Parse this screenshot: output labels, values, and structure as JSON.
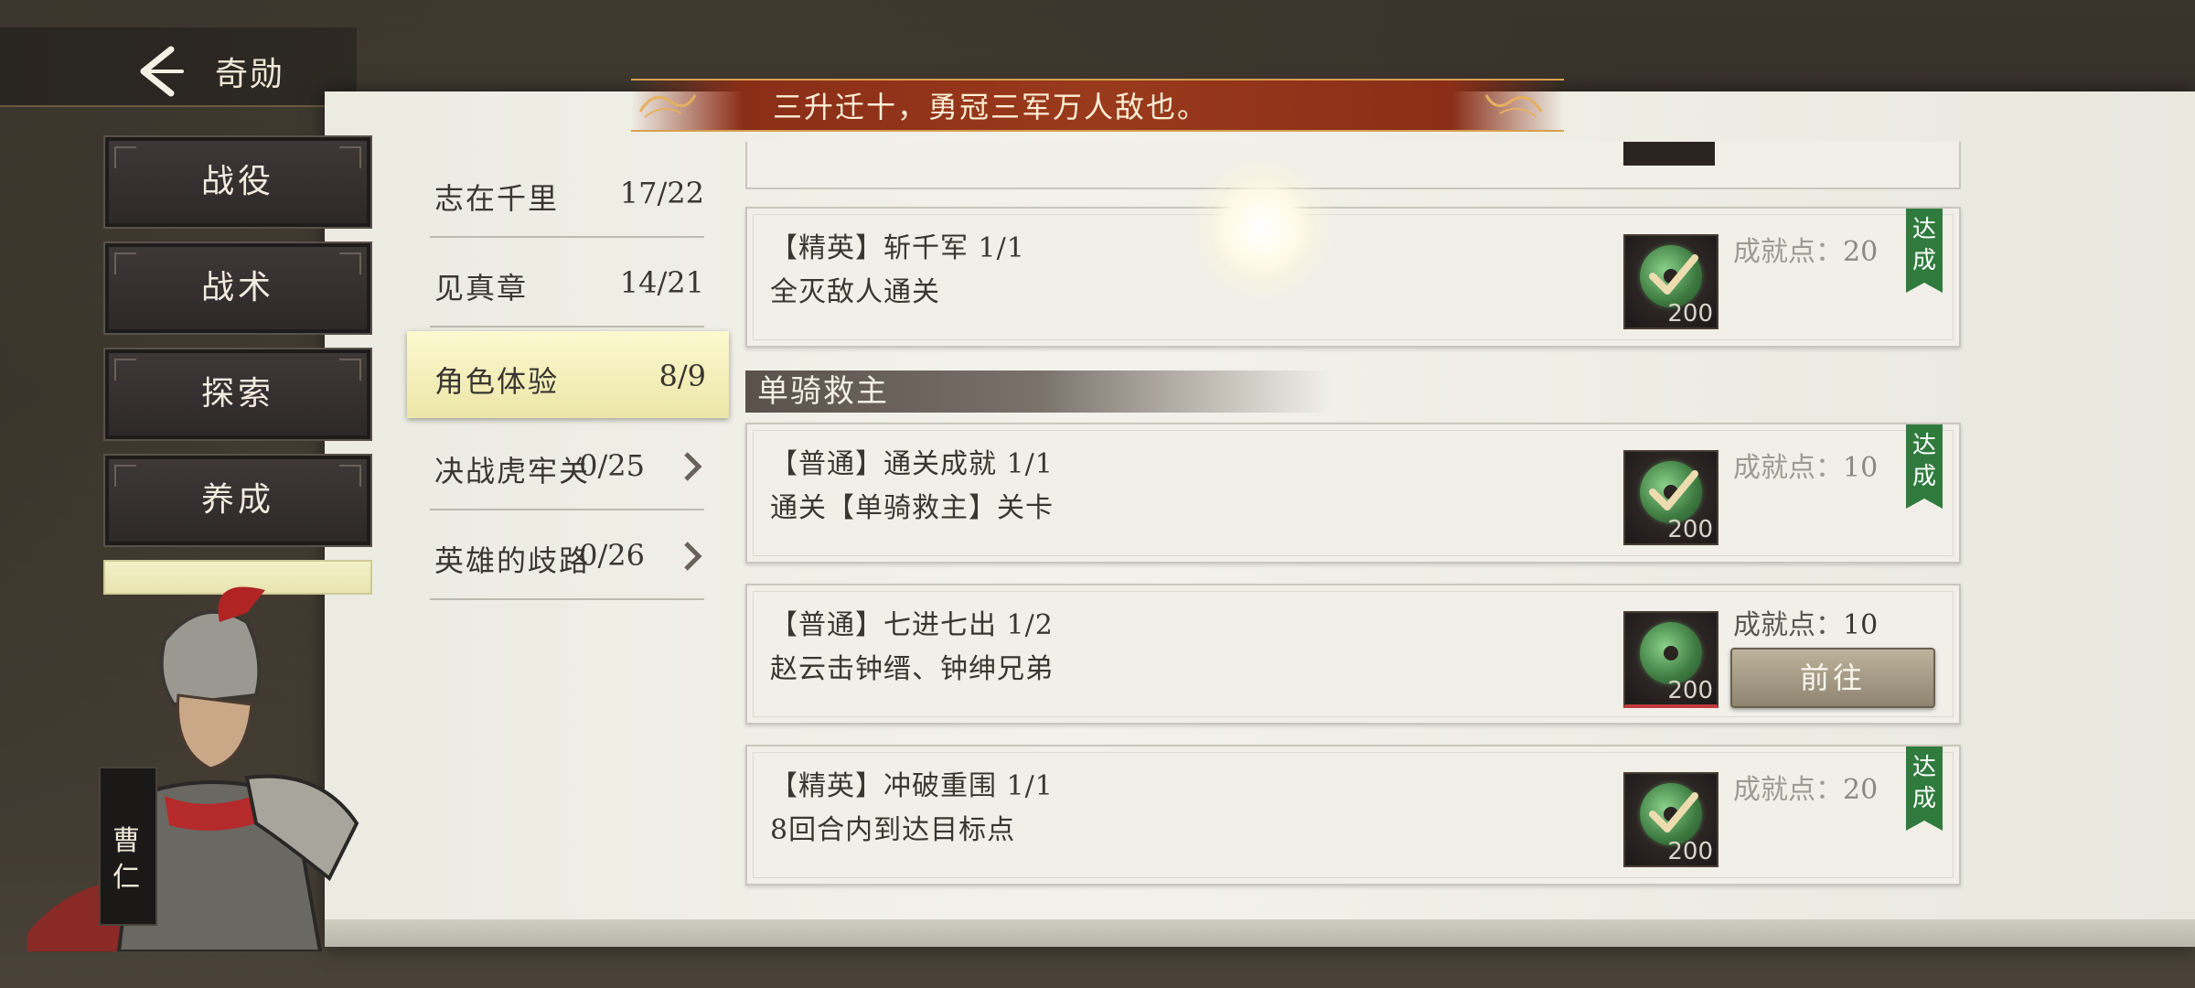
{
  "header": {
    "title": "奇勋",
    "back_icon": "back-arrow-icon",
    "banner_text": "三升迁十，勇冠三军万人敌也。"
  },
  "categories": [
    {
      "label": "战役"
    },
    {
      "label": "战术"
    },
    {
      "label": "探索"
    },
    {
      "label": "养成"
    }
  ],
  "hero": {
    "name": "曹仁"
  },
  "sub_items": [
    {
      "label": "志在千里",
      "count": "17/22"
    },
    {
      "label": "见真章",
      "count": "14/21"
    },
    {
      "label": "角色体验",
      "count": "8/9",
      "active": true
    },
    {
      "label": "决战虎牢关",
      "count": "0/25",
      "has_arrow": true
    },
    {
      "label": "英雄的歧路",
      "count": "0/26",
      "has_arrow": true
    }
  ],
  "section": {
    "title": "单骑救主"
  },
  "cards": [
    {
      "title": "【精英】斩千军 1/1",
      "desc": "全灭敌人通关",
      "reward_count": "200",
      "points_label": "成就点：",
      "points_value": "20",
      "status": "达成",
      "completed": true
    },
    {
      "title": "【普通】通关成就 1/1",
      "desc": "通关【单骑救主】关卡",
      "reward_count": "200",
      "points_label": "成就点：",
      "points_value": "10",
      "status": "达成",
      "completed": true
    },
    {
      "title": "【普通】七进七出 1/2",
      "desc": "赵云击钟缙、钟绅兄弟",
      "reward_count": "200",
      "points_label": "成就点：",
      "points_value": "10",
      "action": "前往",
      "completed": false
    },
    {
      "title": "【精英】冲破重围 1/1",
      "desc": "8回合内到达目标点",
      "reward_count": "200",
      "points_label": "成就点：",
      "points_value": "20",
      "status": "达成",
      "completed": true
    }
  ],
  "colors": {
    "done_tag": "#2f7b3e",
    "active_tab": "#f5f2c0",
    "banner": "#8a2e18"
  }
}
